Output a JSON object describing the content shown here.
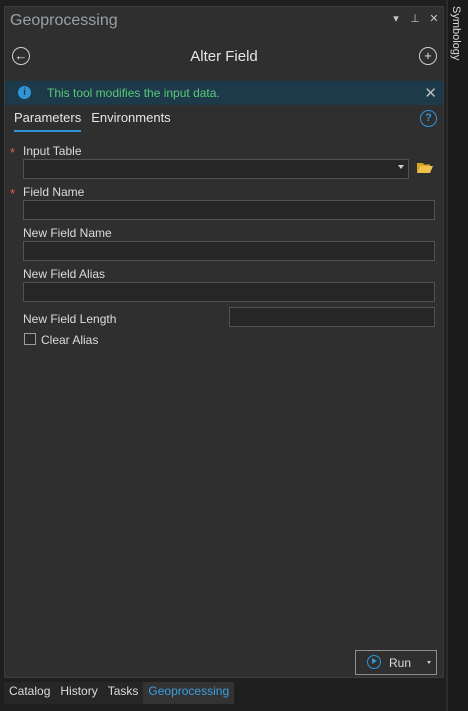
{
  "panel": {
    "title": "Geoprocessing",
    "controls": {
      "menu": "▾",
      "pin": "⊥",
      "close": "✕"
    }
  },
  "tool": {
    "title": "Alter Field",
    "back_icon": "arrow-left-icon",
    "add_icon": "plus-icon"
  },
  "info": {
    "icon": "info-icon",
    "message": "This tool modifies the input data.",
    "close": "✕"
  },
  "tabs": [
    {
      "label": "Parameters",
      "active": true
    },
    {
      "label": "Environments",
      "active": false
    }
  ],
  "help_icon": "?",
  "fields": {
    "input_table": {
      "label": "Input Table",
      "required": true,
      "value": ""
    },
    "field_name": {
      "label": "Field Name",
      "required": true,
      "value": ""
    },
    "new_field_name": {
      "label": "New Field Name",
      "value": ""
    },
    "new_field_alias": {
      "label": "New Field Alias",
      "value": ""
    },
    "new_field_length": {
      "label": "New Field Length",
      "value": ""
    },
    "clear_alias": {
      "label": "Clear Alias",
      "checked": false
    }
  },
  "required_marker": "*",
  "run": {
    "label": "Run"
  },
  "bottom_tabs": [
    {
      "label": "Catalog",
      "active": false
    },
    {
      "label": "History",
      "active": false
    },
    {
      "label": "Tasks",
      "active": false
    },
    {
      "label": "Geoprocessing",
      "active": true
    }
  ],
  "side_panel": {
    "label": "Symbology"
  },
  "colors": {
    "accent": "#2f95d8",
    "info_background": "#1c3a4a",
    "info_text": "#5ac879",
    "required": "#e06040"
  }
}
